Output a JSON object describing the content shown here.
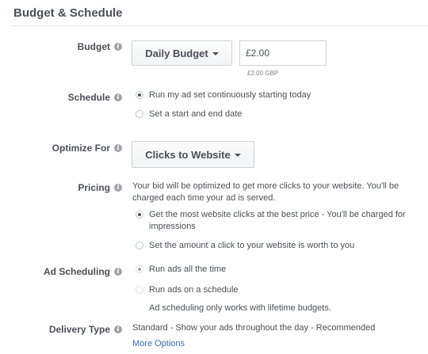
{
  "section": {
    "title": "Budget & Schedule"
  },
  "budget": {
    "label": "Budget",
    "type_dropdown": "Daily Budget",
    "amount_value": "£2.00",
    "amount_note": "£2.00 GBP"
  },
  "schedule": {
    "label": "Schedule",
    "options": [
      {
        "text": "Run my ad set continuously starting today",
        "selected": true
      },
      {
        "text": "Set a start and end date",
        "selected": false
      }
    ]
  },
  "optimize": {
    "label": "Optimize For",
    "dropdown": "Clicks to Website"
  },
  "pricing": {
    "label": "Pricing",
    "description": "Your bid will be optimized to get more clicks to your website. You'll be charged each time your ad is served.",
    "options": [
      {
        "text": "Get the most website clicks at the best price - You'll be charged for impressions",
        "selected": true
      },
      {
        "text": "Set the amount a click to your website is worth to you",
        "selected": false
      }
    ]
  },
  "ad_scheduling": {
    "label": "Ad Scheduling",
    "options": [
      {
        "text": "Run ads all the time",
        "selected": true
      },
      {
        "text": "Run ads on a schedule",
        "selected": false
      }
    ],
    "note": "Ad scheduling only works with lifetime budgets."
  },
  "delivery": {
    "label": "Delivery Type",
    "value": "Standard - Show your ads throughout the day - Recommended",
    "more_link": "More Options"
  },
  "icons": {
    "info": "info-icon",
    "caret": "chevron-down-icon"
  },
  "colors": {
    "text": "#4b4f56",
    "link": "#4267b2",
    "border": "#cfd1d5"
  }
}
